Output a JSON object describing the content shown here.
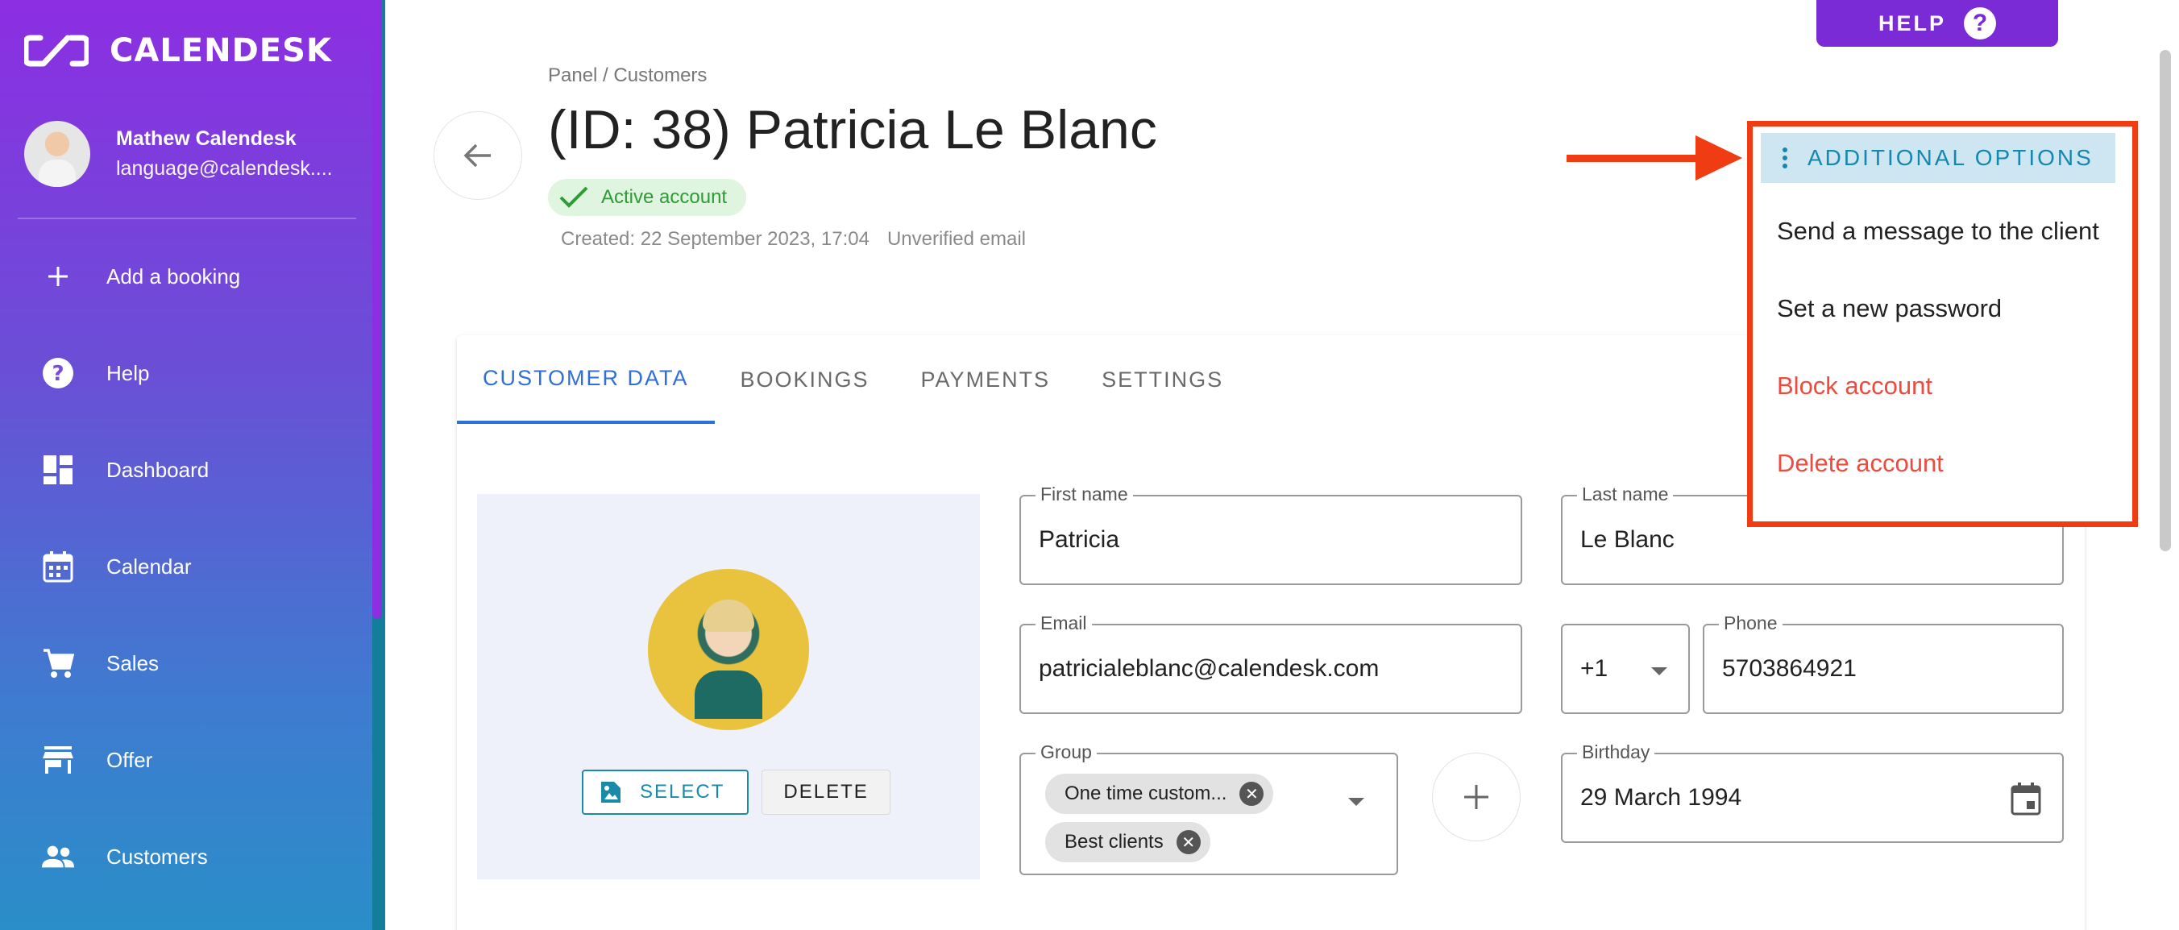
{
  "app": {
    "brand": "CALENDESK"
  },
  "user": {
    "name": "Mathew Calendesk",
    "email": "language@calendesk...."
  },
  "sidebar": {
    "items": [
      {
        "label": "Add a booking",
        "icon": "plus-icon"
      },
      {
        "label": "Help",
        "icon": "help-circle-icon"
      },
      {
        "label": "Dashboard",
        "icon": "dashboard-icon"
      },
      {
        "label": "Calendar",
        "icon": "calendar-icon"
      },
      {
        "label": "Sales",
        "icon": "cart-icon"
      },
      {
        "label": "Offer",
        "icon": "store-icon"
      },
      {
        "label": "Customers",
        "icon": "people-icon"
      }
    ]
  },
  "help": {
    "label": "HELP",
    "icon_glyph": "?"
  },
  "header": {
    "breadcrumb": "Panel / Customers",
    "title": "(ID: 38) Patricia Le Blanc",
    "status": "Active account",
    "created": "Created: 22 September 2023, 17:04",
    "email_status": "Unverified email"
  },
  "tabs": [
    {
      "label": "CUSTOMER DATA",
      "active": true
    },
    {
      "label": "BOOKINGS",
      "active": false
    },
    {
      "label": "PAYMENTS",
      "active": false
    },
    {
      "label": "SETTINGS",
      "active": false
    }
  ],
  "photo": {
    "select_label": "SELECT",
    "delete_label": "DELETE"
  },
  "form": {
    "first_name": {
      "label": "First name",
      "value": "Patricia"
    },
    "last_name": {
      "label": "Last name",
      "value": "Le Blanc"
    },
    "email": {
      "label": "Email",
      "value": "patricialeblanc@calendesk.com"
    },
    "phone_code": {
      "value": "+1"
    },
    "phone": {
      "label": "Phone",
      "value": "5703864921"
    },
    "group": {
      "label": "Group",
      "chips": [
        "One time custom...",
        "Best clients"
      ]
    },
    "birthday": {
      "label": "Birthday",
      "value": "29 March 1994"
    }
  },
  "menu": {
    "title": "ADDITIONAL OPTIONS",
    "items": [
      {
        "label": "Send a message to the client",
        "danger": false
      },
      {
        "label": "Set a new password",
        "danger": false
      },
      {
        "label": "Block account",
        "danger": true
      },
      {
        "label": "Delete account",
        "danger": true
      }
    ]
  },
  "colors": {
    "accent": "#2f6fd8",
    "brand_purple": "#7b2bd6",
    "annotation_red": "#f03c13",
    "danger": "#ee4a3e",
    "success": "#2e9b35"
  }
}
